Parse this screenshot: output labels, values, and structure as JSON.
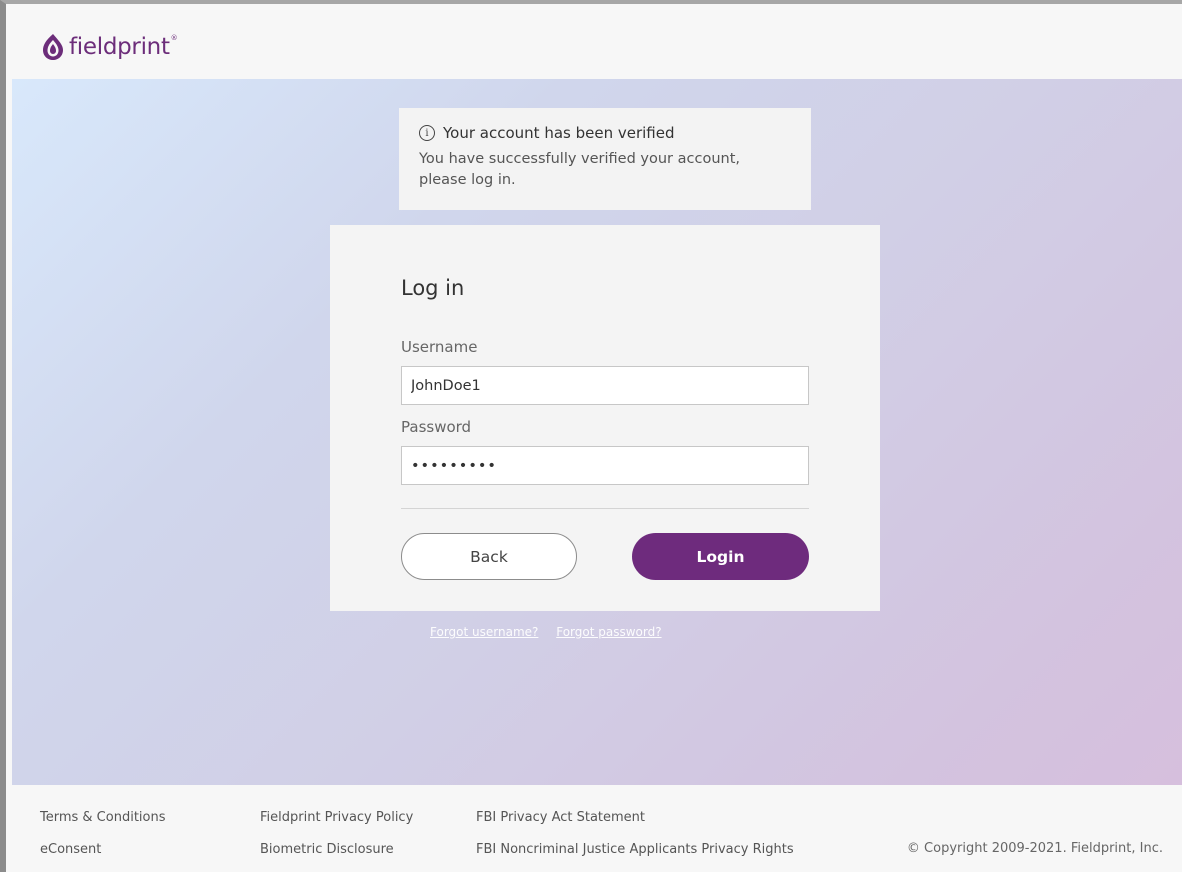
{
  "brand": {
    "name": "fieldprint",
    "tm": "®",
    "color": "#6c2d7a"
  },
  "notice": {
    "icon": "info-icon",
    "title": "Your account has been verified",
    "body": "You have successfully verified your account, please log in."
  },
  "login": {
    "title": "Log in",
    "username_label": "Username",
    "username_value": "JohnDoe1",
    "password_label": "Password",
    "password_value": "•••••••••",
    "back_label": "Back",
    "login_label": "Login",
    "login_color": "#6e2b7d"
  },
  "help_links": {
    "forgot_username": "Forgot username?",
    "forgot_password": "Forgot password?"
  },
  "footer": {
    "terms": "Terms & Conditions",
    "econsent": "eConsent",
    "privacy_policy": "Fieldprint Privacy Policy",
    "biometric": "Biometric Disclosure",
    "fbi_privacy_act": "FBI Privacy Act Statement",
    "fbi_rights": "FBI Noncriminal Justice Applicants Privacy Rights",
    "copyright": "© Copyright 2009-2021. Fieldprint, Inc."
  }
}
